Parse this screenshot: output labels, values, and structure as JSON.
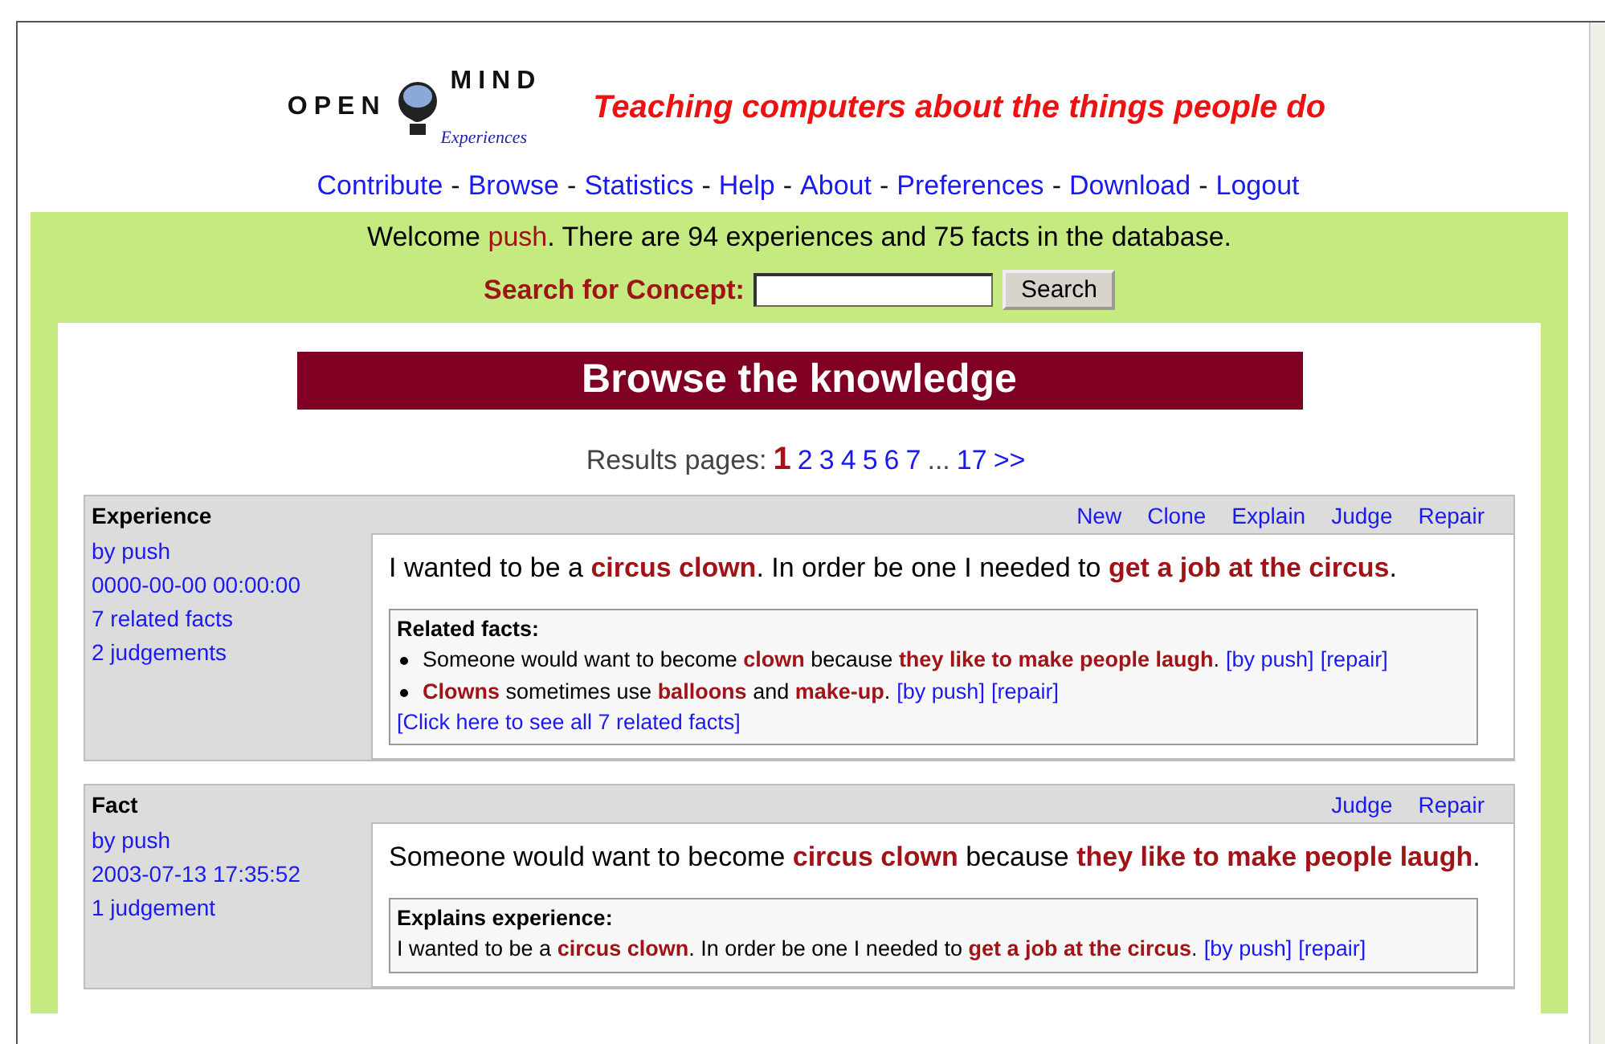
{
  "header": {
    "logo_left": "OPEN",
    "logo_right": "MIND",
    "logo_sub": "Experiences",
    "tagline": "Teaching computers about the things people do"
  },
  "nav": {
    "separator": "-",
    "links": [
      "Contribute",
      "Browse",
      "Statistics",
      "Help",
      "About",
      "Preferences",
      "Download",
      "Logout"
    ]
  },
  "welcome": "Welcome **push**. There are 94 experiences and 75 facts in the database.",
  "search": {
    "label": "Search for Concept:",
    "button": "Search"
  },
  "title": "Browse the knowledge",
  "pagination": {
    "label": "Results pages:",
    "items": [
      {
        "kind": "page",
        "label": "1",
        "selected": true
      },
      {
        "kind": "page",
        "label": "2",
        "selected": false
      },
      {
        "kind": "page",
        "label": "3",
        "selected": false
      },
      {
        "kind": "page",
        "label": "4",
        "selected": false
      },
      {
        "kind": "page",
        "label": "5",
        "selected": false
      },
      {
        "kind": "page",
        "label": "6",
        "selected": false
      },
      {
        "kind": "page",
        "label": "7",
        "selected": false
      },
      {
        "kind": "ellipsis",
        "label": "..."
      },
      {
        "kind": "page",
        "label": "17",
        "selected": false
      },
      {
        "kind": "page",
        "label": ">>",
        "selected": false
      }
    ]
  },
  "entries": [
    {
      "kind": "experience",
      "heading": "Experience",
      "meta": [
        "by push",
        "0000-00-00 00:00:00",
        "7 related facts",
        "2 judgements"
      ],
      "actions": [
        "New",
        "Clone",
        "Explain",
        "Judge",
        "Repair"
      ],
      "text": "I wanted to be a **circus clown**. In order be one I needed to **get a job at the circus**.",
      "box": {
        "title": "Related facts:",
        "items": [
          {
            "text": "Someone would want to become **clown** because **they like to make people laugh**.",
            "links": [
              "[by push]",
              "[repair]"
            ]
          },
          {
            "text": "**Clowns** sometimes use **balloons** and **make-up**.",
            "links": [
              "[by push]",
              "[repair]"
            ]
          }
        ],
        "more": "[Click here to see all 7 related facts]"
      }
    },
    {
      "kind": "fact",
      "heading": "Fact",
      "meta": [
        "by push",
        "2003-07-13 17:35:52",
        "1 judgement"
      ],
      "actions": [
        "Judge",
        "Repair"
      ],
      "text": "Someone would want to become **circus clown** because **they like to make people laugh**.",
      "box": {
        "title": "Explains experience:",
        "items": [
          {
            "text": "I wanted to be a **circus clown**. In order be one I needed to **get a job at the circus**.",
            "links": [
              "[by push]",
              "[repair]"
            ]
          }
        ]
      }
    }
  ]
}
